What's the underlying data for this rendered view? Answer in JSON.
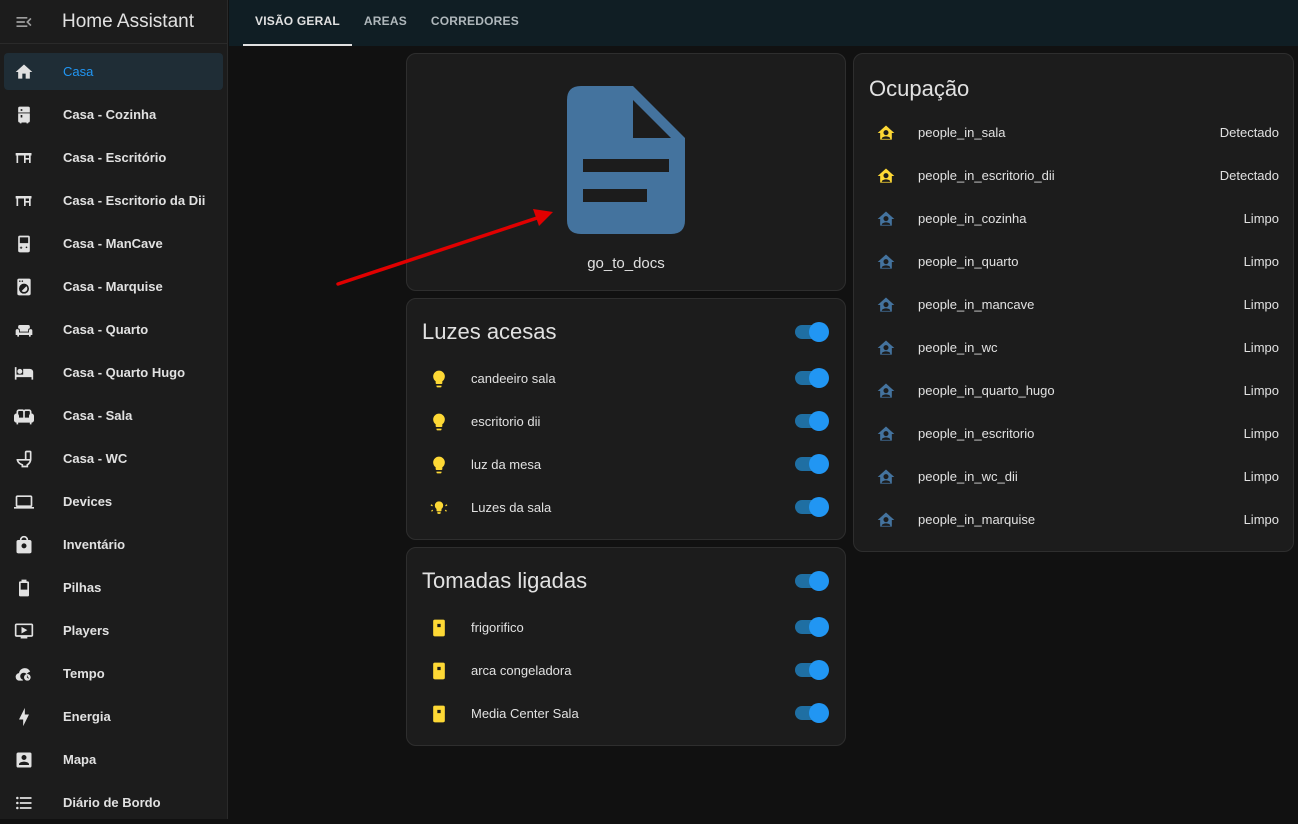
{
  "app": {
    "title": "Home Assistant"
  },
  "sidebar": {
    "items": [
      {
        "label": "Casa",
        "icon": "home-icon",
        "active": true
      },
      {
        "label": "Casa - Cozinha",
        "icon": "fridge-icon"
      },
      {
        "label": "Casa - Escritório",
        "icon": "desk-icon"
      },
      {
        "label": "Casa - Escritorio da Dii",
        "icon": "desk-icon"
      },
      {
        "label": "Casa - ManCave",
        "icon": "gameboy-icon"
      },
      {
        "label": "Casa - Marquise",
        "icon": "washing-machine-icon"
      },
      {
        "label": "Casa - Quarto",
        "icon": "sofa-icon"
      },
      {
        "label": "Casa - Quarto Hugo",
        "icon": "bed-icon"
      },
      {
        "label": "Casa - Sala",
        "icon": "couch-icon"
      },
      {
        "label": "Casa - WC",
        "icon": "toilet-icon"
      },
      {
        "label": "Devices",
        "icon": "devices-icon"
      },
      {
        "label": "Inventário",
        "icon": "bag-icon"
      },
      {
        "label": "Pilhas",
        "icon": "battery-icon"
      },
      {
        "label": "Players",
        "icon": "play-box-icon"
      },
      {
        "label": "Tempo",
        "icon": "weather-cloud-clock-icon"
      },
      {
        "label": "Energia",
        "icon": "lightning-icon"
      },
      {
        "label": "Mapa",
        "icon": "account-box-icon"
      },
      {
        "label": "Diário de Bordo",
        "icon": "format-list-icon"
      }
    ]
  },
  "tabs": [
    {
      "label": "VISÃO GERAL",
      "active": true
    },
    {
      "label": "AREAS"
    },
    {
      "label": "CORREDORES"
    }
  ],
  "docs_card": {
    "name": "go_to_docs",
    "icon": "file-document-icon"
  },
  "lights_card": {
    "title": "Luzes acesas",
    "master_on": true,
    "items": [
      {
        "name": "candeeiro sala",
        "icon": "lightbulb-icon",
        "on": true
      },
      {
        "name": "escritorio dii",
        "icon": "lightbulb-icon",
        "on": true
      },
      {
        "name": "luz da mesa",
        "icon": "lightbulb-icon",
        "on": true
      },
      {
        "name": "Luzes da sala",
        "icon": "lightbulb-group-icon",
        "on": true
      }
    ]
  },
  "plugs_card": {
    "title": "Tomadas ligadas",
    "master_on": true,
    "items": [
      {
        "name": "frigorifico",
        "icon": "power-socket-icon",
        "on": true
      },
      {
        "name": "arca congeladora",
        "icon": "power-socket-icon",
        "on": true
      },
      {
        "name": "Media Center Sala",
        "icon": "power-socket-icon",
        "on": true
      }
    ]
  },
  "occupancy_card": {
    "title": "Ocupação",
    "items": [
      {
        "name": "people_in_sala",
        "state": "Detectado",
        "icon": "home-account-icon",
        "active": true
      },
      {
        "name": "people_in_escritorio_dii",
        "state": "Detectado",
        "icon": "home-account-icon",
        "active": true
      },
      {
        "name": "people_in_cozinha",
        "state": "Limpo",
        "icon": "home-account-icon"
      },
      {
        "name": "people_in_quarto",
        "state": "Limpo",
        "icon": "home-account-icon"
      },
      {
        "name": "people_in_mancave",
        "state": "Limpo",
        "icon": "home-account-icon"
      },
      {
        "name": "people_in_wc",
        "state": "Limpo",
        "icon": "home-account-icon"
      },
      {
        "name": "people_in_quarto_hugo",
        "state": "Limpo",
        "icon": "home-account-icon"
      },
      {
        "name": "people_in_escritorio",
        "state": "Limpo",
        "icon": "home-account-icon"
      },
      {
        "name": "people_in_wc_dii",
        "state": "Limpo",
        "icon": "home-account-icon"
      },
      {
        "name": "people_in_marquise",
        "state": "Limpo",
        "icon": "home-account-icon"
      }
    ]
  },
  "colors": {
    "accent": "#2196f3",
    "active_icon": "#fdd835",
    "inactive_icon": "#44739e",
    "arrow": "#e00000"
  }
}
